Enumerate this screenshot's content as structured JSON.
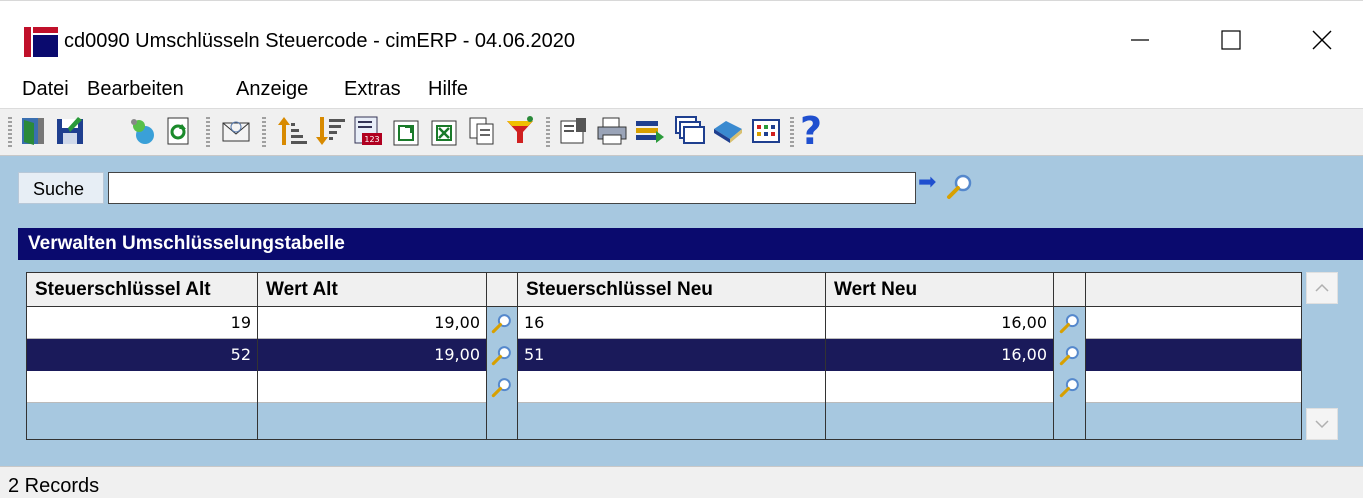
{
  "window": {
    "title": "cd0090 Umschlüsseln Steuercode - cimERP - 04.06.2020",
    "minimize_label": "—",
    "maximize_label": "☐",
    "close_label": "✕"
  },
  "menu": {
    "items": [
      {
        "label": "Datei"
      },
      {
        "label": "Bearbeiten"
      },
      {
        "label": "Anzeige"
      },
      {
        "label": "Extras"
      },
      {
        "label": "Hilfe"
      }
    ]
  },
  "toolbar": {
    "icons": [
      "exit-icon",
      "save-icon",
      "new-record-icon",
      "refresh-icon",
      "mail-icon",
      "sort-ascending-icon",
      "sort-descending-icon",
      "number-format-icon",
      "export-icon",
      "excel-export-icon",
      "copy-icon",
      "filter-icon",
      "properties-icon",
      "print-icon",
      "import-icon",
      "windows-icon",
      "book-icon",
      "grid-settings-icon",
      "help-icon"
    ],
    "help_glyph": "?"
  },
  "search": {
    "label": "Suche",
    "value": "",
    "go_glyph": "➡"
  },
  "panel": {
    "title": "Verwalten Umschlüsselungstabelle"
  },
  "table": {
    "headers": {
      "steuer_alt": "Steuerschlüssel Alt",
      "wert_alt": "Wert Alt",
      "steuer_neu": "Steuerschlüssel Neu",
      "wert_neu": "Wert Neu"
    },
    "rows": [
      {
        "steuer_alt": "19",
        "wert_alt": "19,00",
        "steuer_neu": "16",
        "wert_neu": "16,00"
      },
      {
        "steuer_alt": "52",
        "wert_alt": "19,00",
        "steuer_neu": "51",
        "wert_neu": "16,00"
      },
      {
        "steuer_alt": "",
        "wert_alt": "",
        "steuer_neu": "",
        "wert_neu": ""
      }
    ],
    "selected_row": 1
  },
  "status": {
    "records": "2 Records"
  },
  "colors": {
    "accent": "#0a0a6e",
    "selected_row": "#1a1a5a",
    "background": "#a7c8e0",
    "logo_red": "#c0102a"
  }
}
